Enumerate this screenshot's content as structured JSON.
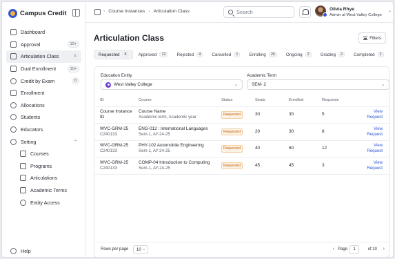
{
  "brand": {
    "name": "Campus Credit"
  },
  "sidebar": {
    "items": [
      {
        "label": "Dashboard",
        "badge": "",
        "icon": "dashboard-icon"
      },
      {
        "label": "Approval",
        "badge": "10+",
        "icon": "approval-icon"
      },
      {
        "label": "Articulation Class",
        "badge": "6",
        "icon": "articulation-icon",
        "active": true
      },
      {
        "label": "Dual Enrollment",
        "badge": "10+",
        "icon": "dual-enrollment-icon"
      },
      {
        "label": "Credit by Exam",
        "badge": "8",
        "icon": "exam-icon"
      },
      {
        "label": "Enrollment",
        "badge": "",
        "icon": "enrollment-icon"
      },
      {
        "label": "Allocations",
        "badge": "",
        "icon": "allocations-icon"
      },
      {
        "label": "Students",
        "badge": "",
        "icon": "students-icon"
      },
      {
        "label": "Educators",
        "badge": "",
        "icon": "educators-icon"
      },
      {
        "label": "Setting",
        "badge": "",
        "icon": "setting-icon",
        "expanded": true
      }
    ],
    "sub_items": [
      {
        "label": "Courses",
        "icon": "courses-icon"
      },
      {
        "label": "Programs",
        "icon": "programs-icon"
      },
      {
        "label": "Articulations",
        "icon": "articulations-icon"
      },
      {
        "label": "Academic Terms",
        "icon": "academic-terms-icon"
      },
      {
        "label": "Entity Access",
        "icon": "entity-access-icon"
      }
    ],
    "help": "Help"
  },
  "topbar": {
    "breadcrumb": [
      "Course Instances",
      "Articulation Class"
    ],
    "search_placeholder": "Search",
    "user": {
      "name": "Olivia Rhye",
      "role": "Admin at West Valley College"
    }
  },
  "page": {
    "title": "Articulation Class",
    "filters_label": "Filters"
  },
  "tabs": [
    {
      "label": "Requested",
      "count": "8",
      "active": true
    },
    {
      "label": "Approved",
      "count": "12"
    },
    {
      "label": "Rejected",
      "count": "4"
    },
    {
      "label": "Cancelled",
      "count": "1"
    },
    {
      "label": "Enrolling",
      "count": "26"
    },
    {
      "label": "Ongoing",
      "count": "2"
    },
    {
      "label": "Grading",
      "count": "2"
    },
    {
      "label": "Completed",
      "count": "2"
    }
  ],
  "filters": {
    "entity_label": "Education Entity",
    "entity_value": "West Valley College",
    "term_label": "Academic Term",
    "term_value": "SEM- 2"
  },
  "table": {
    "headers": [
      "ID",
      "Course",
      "Status",
      "Seats",
      "Enrolled",
      "Requests",
      ""
    ],
    "rows": [
      {
        "id": "Course Instance",
        "id_sub": "ID",
        "course": "Course Name",
        "course_sub": "Academic term, Academic year",
        "status": "Requested",
        "seats": "30",
        "enrolled": "30",
        "requests": "5",
        "action": "View Request"
      },
      {
        "id": "WVC-GRM-25",
        "id_sub": "C240133",
        "course": "ENG-012 : International Languages",
        "course_sub": "Sem-1, AY-24-25",
        "status": "Requested",
        "seats": "20",
        "enrolled": "30",
        "requests": "8",
        "action": "View Request"
      },
      {
        "id": "WVC-GRM-25",
        "id_sub": "C240133",
        "course": "PHY-102 Automobile Engineering",
        "course_sub": "Sem-1, AY-24-25",
        "status": "Requested",
        "seats": "40",
        "enrolled": "60",
        "requests": "12",
        "action": "View Request"
      },
      {
        "id": "WVC-GRM-25",
        "id_sub": "C240133",
        "course": "COMP-04 Introduction to Computing",
        "course_sub": "Sem-1, AY-24-25",
        "status": "Requested",
        "seats": "45",
        "enrolled": "45",
        "requests": "3",
        "action": "View Request"
      }
    ]
  },
  "pagination": {
    "rows_per_page_label": "Rows per page",
    "rows_per_page": "10",
    "page_label": "Page",
    "current_page": "1",
    "of_label": "of 10"
  },
  "colors": {
    "accent": "#2f55d4",
    "status_requested": "#c0641b"
  }
}
